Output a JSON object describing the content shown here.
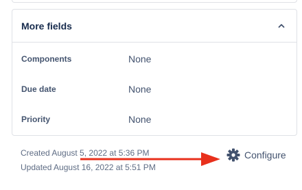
{
  "more_fields": {
    "title": "More fields",
    "fields": [
      {
        "label": "Components",
        "value": "None"
      },
      {
        "label": "Due date",
        "value": "None"
      },
      {
        "label": "Priority",
        "value": "None"
      }
    ]
  },
  "footer": {
    "created": "Created August 5, 2022 at 5:36 PM",
    "updated": "Updated August 16, 2022 at 5:51 PM",
    "configure_label": "Configure"
  },
  "colors": {
    "annotation_arrow": "#e8301c",
    "border": "#dfe1e6",
    "text_primary": "#172b4d",
    "text_secondary": "#5e6c84"
  },
  "icons": {
    "collapse": "chevron-up-icon",
    "configure": "gear-icon"
  }
}
